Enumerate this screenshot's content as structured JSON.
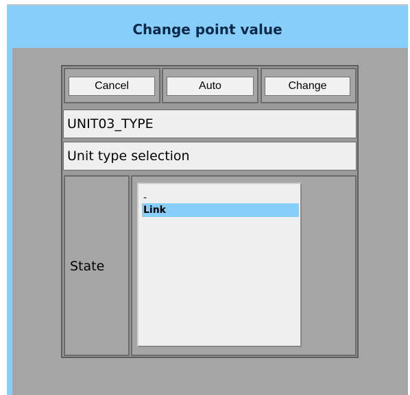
{
  "dialog": {
    "title": "Change point value"
  },
  "buttons": {
    "cancel": "Cancel",
    "auto": "Auto",
    "change": "Change"
  },
  "point": {
    "name": "UNIT03_TYPE",
    "description": "Unit type selection"
  },
  "state": {
    "label": "State",
    "options": [
      {
        "label": "-"
      },
      {
        "label": "Link"
      }
    ],
    "selected": "Link"
  },
  "colors": {
    "titlebar": "#87cefa",
    "selection": "#87cefa",
    "background": "#a5a5a5"
  }
}
